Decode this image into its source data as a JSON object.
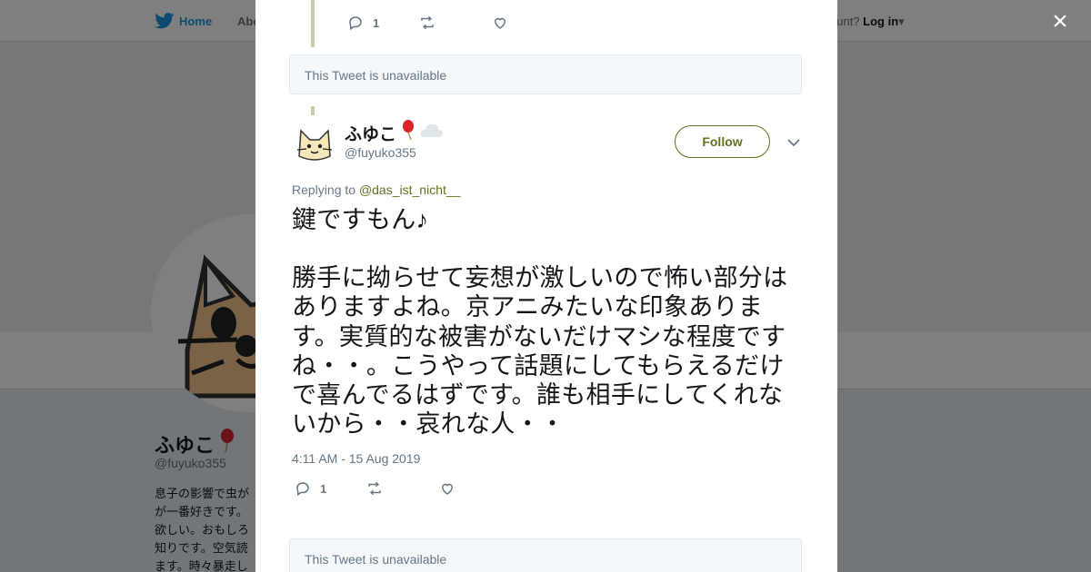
{
  "background": {
    "nav": {
      "home_label": "Home",
      "about_label": "Abo",
      "account_text": "ccount?",
      "login_label": "Log in"
    },
    "profile": {
      "name": "ふゆこ",
      "handle": "@fuyuko355",
      "bio_lines": [
        "息子の影響で虫が",
        "が一番好きです。",
        "欲しい。おもしろ",
        "知りです。空気読",
        "ます。時々暴走し"
      ]
    }
  },
  "modal": {
    "close_label": "×",
    "parent_tweet": {
      "reply_count": "1"
    },
    "unavailable_top": "This Tweet is unavailable",
    "tweet": {
      "display_name": "ふゆこ",
      "handle": "@fuyuko355",
      "follow_label": "Follow",
      "replying_prefix": "Replying to",
      "replying_to": "@das_ist_nicht__",
      "text_line1": "鍵ですもん♪",
      "text_paragraph2": "勝手に拗らせて妄想が激しいので怖い部分はありますよね。京アニみたいな印象あります。実質的な被害がないだけマシな程度ですね・・。こうやって話題にしてもらえるだけで喜んでるはずです。誰も相手にしてくれないから・・哀れな人・・",
      "timestamp": "4:11 AM - 15 Aug 2019",
      "reply_count": "1"
    },
    "unavailable_bottom": "This Tweet is unavailable"
  },
  "colors": {
    "link_accent": "#67701e",
    "twitter_blue": "#1b95e0",
    "thread_line": "#c9cdaa",
    "muted_text": "#657786"
  },
  "icons": [
    "twitter-bird-icon",
    "close-icon",
    "reply-icon",
    "retweet-icon",
    "like-icon",
    "chevron-down-icon",
    "balloon-emoji-icon",
    "cloud-emoji-icon",
    "cat-avatar"
  ]
}
